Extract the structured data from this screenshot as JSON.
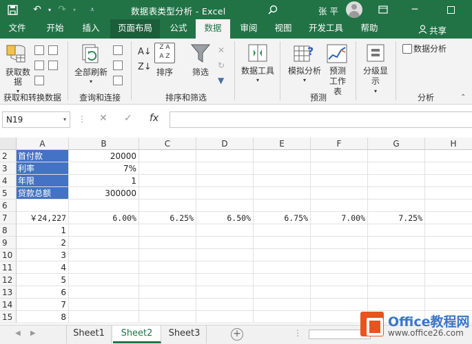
{
  "title_bar": {
    "title": "数据表类型分析  -  Excel",
    "user": "张 平"
  },
  "tabs": [
    "文件",
    "开始",
    "插入",
    "页面布局",
    "公式",
    "数据",
    "审阅",
    "视图",
    "开发工具",
    "帮助"
  ],
  "share_label": "共享",
  "ribbon": {
    "get_data": "获取数据",
    "refresh_all": "全部刷新",
    "sort": "排序",
    "filter": "筛选",
    "data_tools": "数据工具",
    "whatif": "模拟分析",
    "forecast_sheet": "预测工作表",
    "outline": "分级显示",
    "data_analysis": "数据分析",
    "groups": {
      "get_transform": "获取和转换数据",
      "queries": "查询和连接",
      "sort_filter": "排序和筛选",
      "forecast": "预测",
      "analysis": "分析"
    }
  },
  "formula_bar": {
    "name_box": "N19",
    "fx": "fx",
    "value": ""
  },
  "grid": {
    "columns": [
      "A",
      "B",
      "C",
      "D",
      "E",
      "F",
      "G",
      "H"
    ],
    "rows": [
      {
        "row": "2",
        "cells": [
          "首付款",
          "20000",
          "",
          "",
          "",
          "",
          "",
          ""
        ]
      },
      {
        "row": "3",
        "cells": [
          "利率",
          "7%",
          "",
          "",
          "",
          "",
          "",
          ""
        ]
      },
      {
        "row": "4",
        "cells": [
          "年限",
          "1",
          "",
          "",
          "",
          "",
          "",
          ""
        ]
      },
      {
        "row": "5",
        "cells": [
          "贷款总额",
          "300000",
          "",
          "",
          "",
          "",
          "",
          ""
        ]
      },
      {
        "row": "6",
        "cells": [
          "",
          "",
          "",
          "",
          "",
          "",
          "",
          ""
        ]
      },
      {
        "row": "7",
        "cells": [
          "￥24,227",
          "6.00%",
          "6.25%",
          "6.50%",
          "6.75%",
          "7.00%",
          "7.25%",
          ""
        ]
      },
      {
        "row": "8",
        "cells": [
          "1",
          "",
          "",
          "",
          "",
          "",
          "",
          ""
        ]
      },
      {
        "row": "9",
        "cells": [
          "2",
          "",
          "",
          "",
          "",
          "",
          "",
          ""
        ]
      },
      {
        "row": "10",
        "cells": [
          "3",
          "",
          "",
          "",
          "",
          "",
          "",
          ""
        ]
      },
      {
        "row": "11",
        "cells": [
          "4",
          "",
          "",
          "",
          "",
          "",
          "",
          ""
        ]
      },
      {
        "row": "12",
        "cells": [
          "5",
          "",
          "",
          "",
          "",
          "",
          "",
          ""
        ]
      },
      {
        "row": "13",
        "cells": [
          "6",
          "",
          "",
          "",
          "",
          "",
          "",
          ""
        ]
      },
      {
        "row": "14",
        "cells": [
          "7",
          "",
          "",
          "",
          "",
          "",
          "",
          ""
        ]
      },
      {
        "row": "15",
        "cells": [
          "8",
          "",
          "",
          "",
          "",
          "",
          "",
          ""
        ]
      }
    ]
  },
  "sheets": [
    "Sheet1",
    "Sheet2",
    "Sheet3"
  ],
  "active_sheet": "Sheet2",
  "watermark": {
    "title": "Office教程网",
    "url": "www.office26.com"
  },
  "colors": {
    "excel_green": "#217346",
    "highlight_blue": "#4472c4"
  }
}
